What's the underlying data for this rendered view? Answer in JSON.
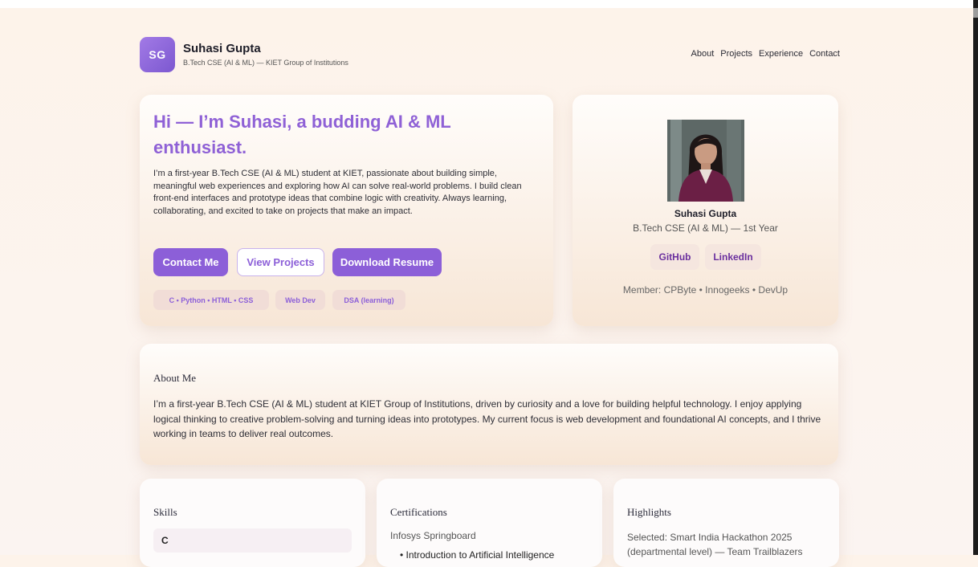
{
  "header": {
    "logo_initials": "SG",
    "name": "Suhasi Gupta",
    "subtitle": "B.Tech CSE (AI & ML) — KIET Group of Institutions",
    "nav": [
      "About",
      "Projects",
      "Experience",
      "Contact"
    ]
  },
  "hero": {
    "title": "Hi — I’m Suhasi, a budding AI & ML enthusiast.",
    "intro": "I’m a first-year B.Tech CSE (AI & ML) student at KIET, passionate about building simple, meaningful web experiences and exploring how AI can solve real-world problems. I build clean front-end interfaces and prototype ideas that combine logic with creativity. Always learning, collaborating, and excited to take on projects that make an impact.",
    "buttons": {
      "contact": "Contact Me",
      "projects": "View Projects",
      "resume": "Download Resume"
    },
    "tags": [
      "C • Python • HTML • CSS",
      "Web Dev",
      "DSA (learning)"
    ]
  },
  "profile": {
    "name": "Suhasi Gupta",
    "degree": "B.Tech CSE (AI & ML) — 1st Year",
    "links": {
      "github": "GitHub",
      "linkedin": "LinkedIn"
    },
    "membership": "Member: CPByte • Innogeeks • DevUp"
  },
  "about": {
    "title": "About Me",
    "text": "I’m a first-year B.Tech CSE (AI & ML) student at KIET Group of Institutions, driven by curiosity and a love for building helpful technology. I enjoy applying logical thinking to creative problem-solving and turning ideas into prototypes. My current focus is web development and foundational AI concepts, and I thrive working in teams to deliver real outcomes."
  },
  "skills": {
    "title": "Skills",
    "items": [
      "C"
    ]
  },
  "certifications": {
    "title": "Certifications",
    "org": "Infosys Springboard",
    "items": [
      "Introduction to Artificial Intelligence"
    ]
  },
  "highlights": {
    "title": "Highlights",
    "text": "Selected: Smart India Hackathon 2025 (departmental level) — Team Trailblazers"
  },
  "colors": {
    "accent": "#8c5fd8",
    "background": "#fdf3ea"
  }
}
